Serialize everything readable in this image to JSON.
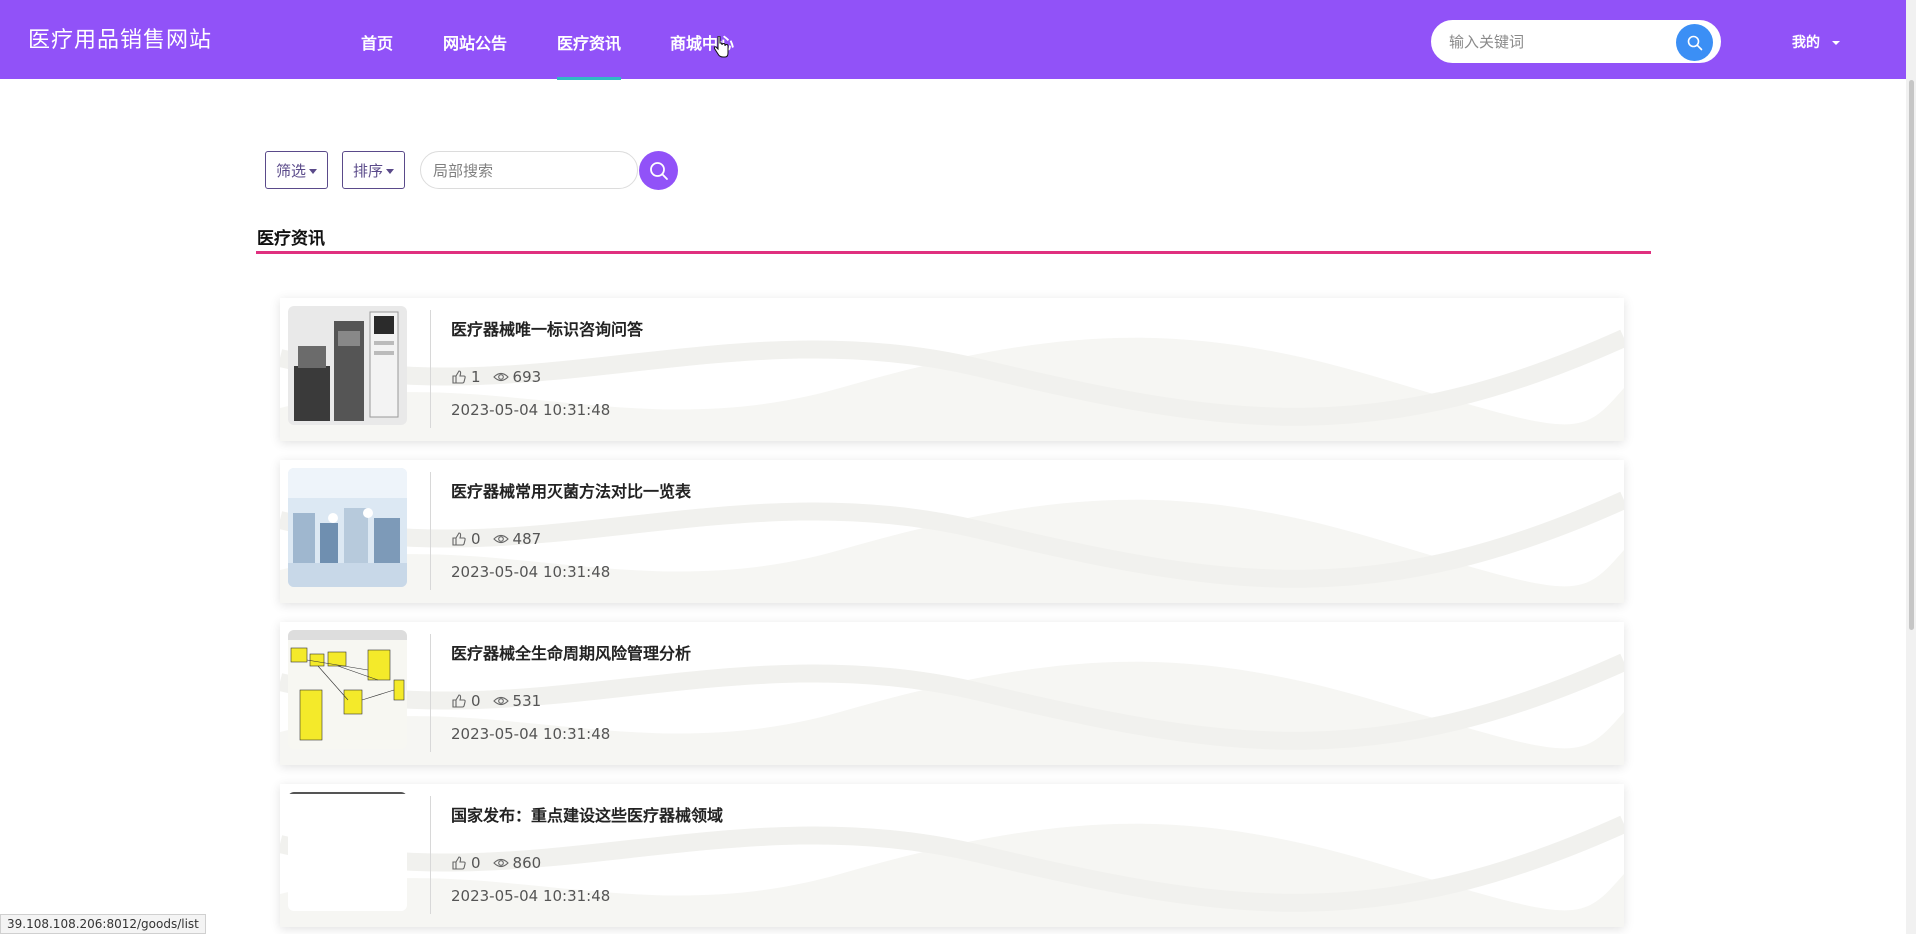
{
  "header": {
    "site_title": "医疗用品销售网站",
    "nav": [
      {
        "label": "首页"
      },
      {
        "label": "网站公告"
      },
      {
        "label": "医疗资讯"
      },
      {
        "label": "商城中心"
      }
    ],
    "active_nav": "医疗资讯",
    "search_placeholder": "输入关键词",
    "user_menu_label": "我的"
  },
  "toolbar": {
    "filter_label": "筛选",
    "sort_label": "排序",
    "local_search_placeholder": "局部搜索"
  },
  "section": {
    "title": "医疗资讯"
  },
  "articles": [
    {
      "title": "医疗器械唯一标识咨询问答",
      "likes": "1",
      "views": "693",
      "date": "2023-05-04 10:31:48"
    },
    {
      "title": "医疗器械常用灭菌方法对比一览表",
      "likes": "0",
      "views": "487",
      "date": "2023-05-04 10:31:48"
    },
    {
      "title": "医疗器械全生命周期风险管理分析",
      "likes": "0",
      "views": "531",
      "date": "2023-05-04 10:31:48"
    },
    {
      "title": "国家发布：重点建设这些医疗器械领域",
      "likes": "0",
      "views": "860",
      "date": "2023-05-04 10:31:48"
    }
  ],
  "status_bar": {
    "url": "39.108.108.206:8012/goods/list"
  },
  "colors": {
    "header_bg": "#9152f8",
    "active_underline": "#2fb9c5",
    "section_line": "#e0307f",
    "search_button": "#3b8ff5"
  }
}
